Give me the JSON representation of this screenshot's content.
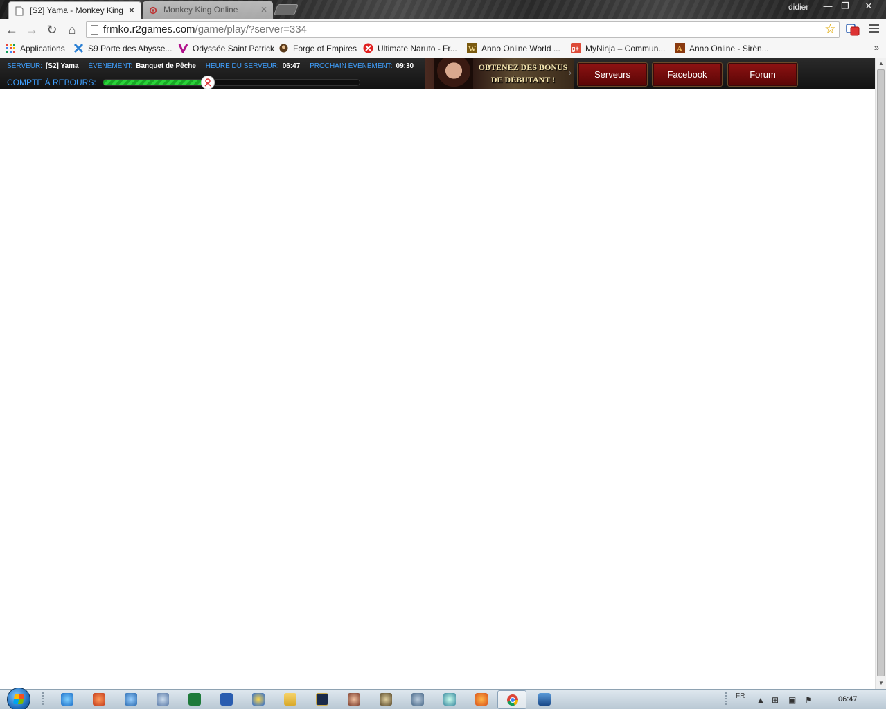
{
  "window": {
    "user": "didier",
    "buttons": {
      "minimize": "—",
      "restore": "❐",
      "close": "✕"
    }
  },
  "tabs": [
    {
      "title": "[S2] Yama - Monkey King",
      "close": "✕",
      "active": true
    },
    {
      "title": "Monkey King Online",
      "close": "✕",
      "active": false
    }
  ],
  "toolbar": {
    "url_host": "frmko.r2games.com",
    "url_path": "/game/play/?server=334",
    "back": "←",
    "forward": "→",
    "reload": "↻",
    "home": "⌂",
    "star": "☆"
  },
  "bookmarks": {
    "items": [
      {
        "label": "Applications",
        "icon": "apps-grid-icon",
        "color": "#e8453c"
      },
      {
        "label": "S9 Porte des Abysse...",
        "icon": "s9-icon",
        "color": "#2a7fd4"
      },
      {
        "label": "Odyssée Saint Patrick",
        "icon": "odyssee-icon",
        "color": "#b0108a"
      },
      {
        "label": "Forge of Empires",
        "icon": "forge-icon",
        "color": "#5a3a1a"
      },
      {
        "label": "Ultimate Naruto - Fr...",
        "icon": "naruto-icon",
        "color": "#e02020"
      },
      {
        "label": "Anno Online World ...",
        "icon": "anno-world-icon",
        "color": "#7a5a10"
      },
      {
        "label": "MyNinja – Commun...",
        "icon": "google-plus-icon",
        "color": "#dd4b39"
      },
      {
        "label": "Anno Online - Sirèn...",
        "icon": "anno-icon",
        "color": "#8a3a10"
      }
    ],
    "more": "»"
  },
  "site": {
    "server_label": "SERVEUR:",
    "server_value": "[S2] Yama",
    "event_label": "ÉVÈNEMENT:",
    "event_value": "Banquet de Pêche",
    "time_label": "HEURE DU SERVEUR:",
    "time_value": "06:47",
    "next_label": "PROCHAIN ÉVÈNEMENT:",
    "next_value": "09:30",
    "countdown_label": "COMPTE À REBOURS:",
    "countdown_progress": 0.41,
    "promo_line1": "OBTENEZ DES BONUS",
    "promo_line2": "DE DÉBUTANT !",
    "promo_arrow": "›",
    "buttons": {
      "servers": "Serveurs",
      "facebook": "Facebook",
      "forum": "Forum"
    }
  },
  "taskbar": {
    "lang": "FR",
    "clock": "06:47"
  }
}
